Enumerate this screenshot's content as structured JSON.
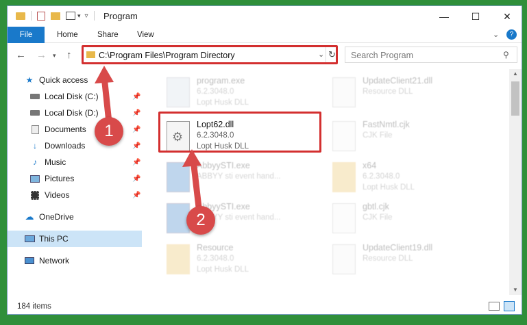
{
  "window": {
    "title": "Program"
  },
  "ribbon": {
    "tabs": [
      "File",
      "Home",
      "Share",
      "View"
    ]
  },
  "nav": {
    "address": "C:\\Program Files\\Program Directory",
    "search_placeholder": "Search Program"
  },
  "sidebar": {
    "items": [
      {
        "label": "Quick access"
      },
      {
        "label": "Local Disk (C:)"
      },
      {
        "label": "Local Disk (D:)"
      },
      {
        "label": "Documents"
      },
      {
        "label": "Downloads"
      },
      {
        "label": "Music"
      },
      {
        "label": "Pictures"
      },
      {
        "label": "Videos"
      },
      {
        "label": "OneDrive"
      },
      {
        "label": "This PC"
      },
      {
        "label": "Network"
      }
    ]
  },
  "files": [
    {
      "name": "program.exe",
      "version": "6.2.3048.0",
      "desc": "Lopt Husk DLL"
    },
    {
      "name": "UpdateClient21.dll",
      "version": "Resource DLL",
      "desc": ""
    },
    {
      "name": "Lopt62.dll",
      "version": "6.2.3048.0",
      "desc": "Lopt Husk DLL"
    },
    {
      "name": "FastNmtl.cjk",
      "version": "CJK File",
      "desc": ""
    },
    {
      "name": "AbbyySTI.exe",
      "version": "ABBYY sti event hand...",
      "desc": ""
    },
    {
      "name": "x64",
      "version": "6.2.3048.0",
      "desc": "Lopt Husk DLL"
    },
    {
      "name": "AbbyySTI.exe",
      "version": "ABBYY sti event hand...",
      "desc": ""
    },
    {
      "name": "gbtl.cjk",
      "version": "CJK File",
      "desc": ""
    },
    {
      "name": "Resource",
      "version": "6.2.3048.0",
      "desc": "Lopt Husk DLL"
    },
    {
      "name": "UpdateClient19.dll",
      "version": "Resource DLL",
      "desc": ""
    }
  ],
  "status": {
    "count": "184 items"
  },
  "annotations": {
    "badge1": "1",
    "badge2": "2"
  },
  "colors": {
    "accent": "#1979ca",
    "highlight": "#d32f2f",
    "badge": "#d84a4a",
    "selected": "#cce4f7"
  }
}
